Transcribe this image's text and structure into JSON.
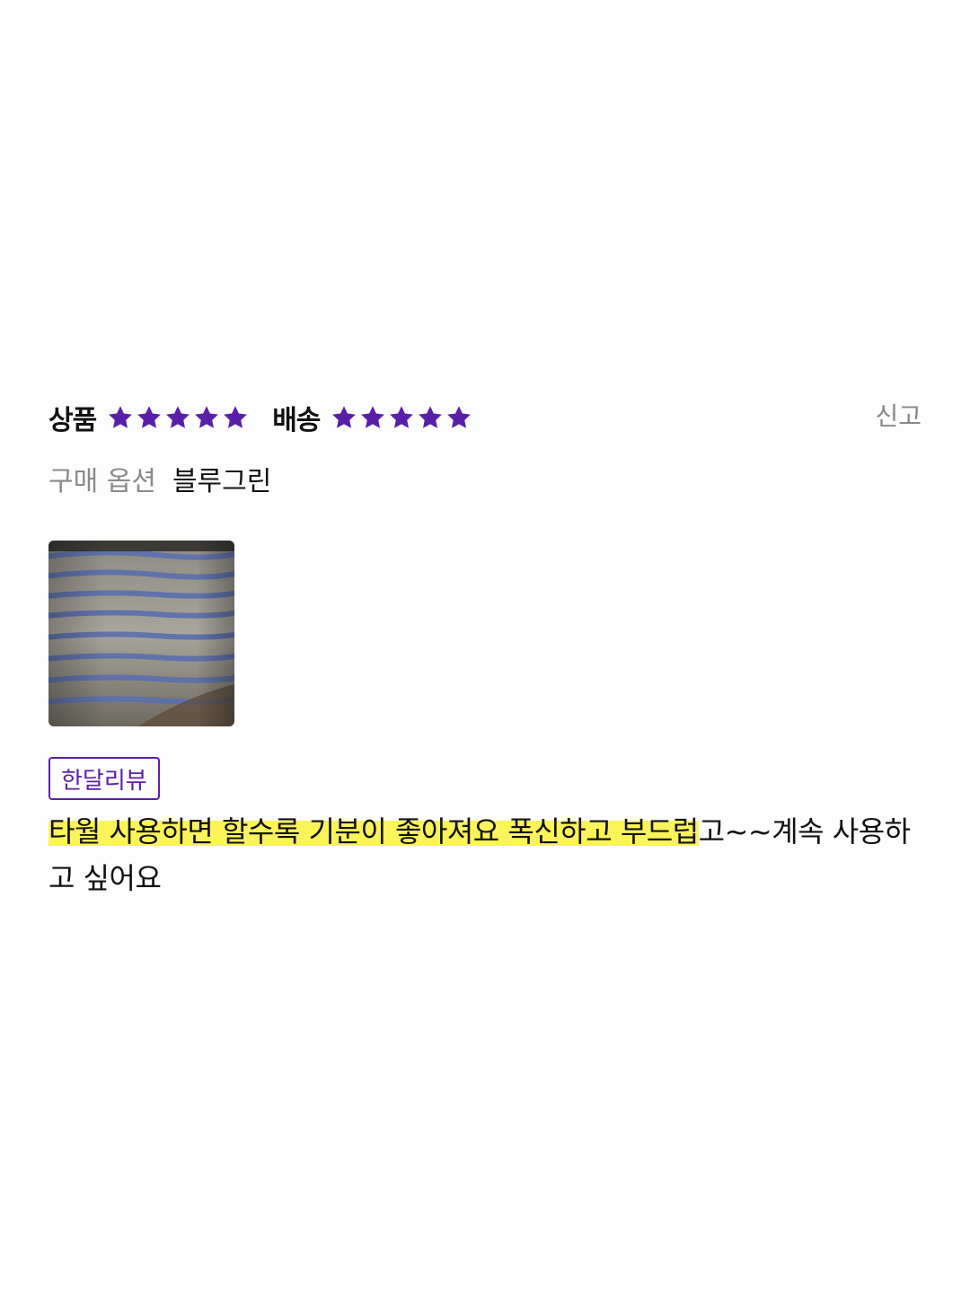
{
  "ratings": {
    "product_label": "상품",
    "product_stars": 5,
    "delivery_label": "배송",
    "delivery_stars": 5,
    "star_color": "#5a1fa8"
  },
  "report_label": "신고",
  "purchase_option": {
    "label": "구매 옵션",
    "value": "블루그린"
  },
  "photo": {
    "icon": "towel-photo"
  },
  "badge_label": "한달리뷰",
  "review": {
    "highlighted_text": "타월 사용하면 할수록 기분이 좋아져요 폭신하고 부드럽",
    "rest_text": "고~~계속 사용하고 싶어요",
    "highlight_color": "#fbf35a"
  }
}
